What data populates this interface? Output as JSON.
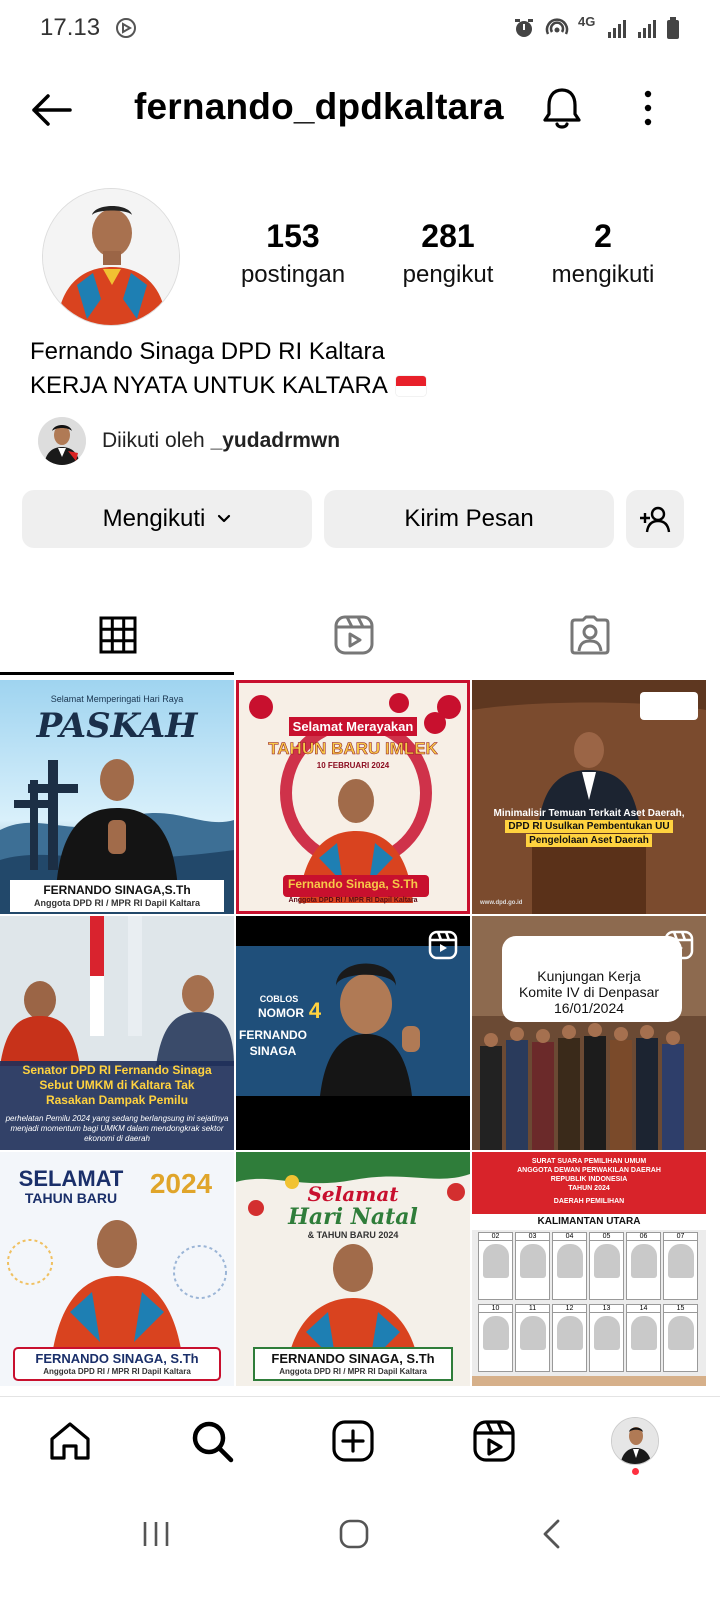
{
  "status_bar": {
    "time": "17.13",
    "network": "4G"
  },
  "header": {
    "username": "fernando_dpdkaltara"
  },
  "profile": {
    "stats": [
      {
        "value": "153",
        "label": "postingan"
      },
      {
        "value": "281",
        "label": "pengikut"
      },
      {
        "value": "2",
        "label": "mengikuti"
      }
    ],
    "display_name": "Fernando Sinaga DPD RI Kaltara",
    "bio": "KERJA NYATA UNTUK KALTARA",
    "followed_by_prefix": "Diikuti oleh",
    "followed_by_user": "_yudadrmwn"
  },
  "actions": {
    "following_label": "Mengikuti",
    "message_label": "Kirim Pesan"
  },
  "posts": [
    {
      "lines": [
        "Selamat Memperingati Hari Raya",
        "PASKAH",
        "FERNANDO SINAGA,S.Th",
        "Anggota DPD RI / MPR RI Dapil Kaltara"
      ]
    },
    {
      "lines": [
        "Selamat Merayakan",
        "TAHUN BARU IMLEK",
        "10 FEBRUARI 2024",
        "Fernando Sinaga, S.Th",
        "Anggota DPD RI / MPR RI Dapil Kaltara"
      ]
    },
    {
      "lines": [
        "Minimalisir Temuan Terkait Aset Daerah,",
        "DPD RI Usulkan Pembentukan UU",
        "Pengelolaan Aset Daerah",
        "www.dpd.go.id"
      ]
    },
    {
      "lines": [
        "Senator DPD RI Fernando Sinaga",
        "Sebut UMKM di Kaltara Tak",
        "Rasakan Dampak Pemilu",
        "perhelatan Pemilu 2024 yang sedang berlangsung ini sejatinya menjadi momentum bagi UMKM dalam mendongkrak sektor ekonomi di daerah"
      ]
    },
    {
      "lines": [
        "COBLOS",
        "NOMOR",
        "4",
        "FERNANDO",
        "SINAGA"
      ],
      "reel": true
    },
    {
      "lines": [
        "Kunjungan Kerja",
        "Komite IV di Denpasar",
        "16/01/2024"
      ],
      "reel": true
    },
    {
      "lines": [
        "SELAMAT",
        "TAHUN BARU",
        "2024",
        "FERNANDO SINAGA, S.Th",
        "Anggota DPD RI / MPR RI Dapil Kaltara"
      ]
    },
    {
      "lines": [
        "Selamat",
        "Hari Natal",
        "& TAHUN BARU 2024",
        "FERNANDO SINAGA, S.Th",
        "Anggota DPD RI / MPR RI Dapil Kaltara"
      ]
    },
    {
      "lines": [
        "SURAT SUARA PEMILIHAN UMUM",
        "ANGGOTA DEWAN PERWAKILAN DAERAH",
        "REPUBLIK INDONESIA",
        "TAHUN 2024",
        "DAERAH PEMILIHAN",
        "KALIMANTAN UTARA"
      ],
      "numbers": [
        "02",
        "03",
        "04",
        "05",
        "06",
        "07",
        "10",
        "11",
        "12",
        "13",
        "14",
        "15"
      ]
    }
  ],
  "colors": {
    "button_bg": "#efefef",
    "notification_dot": "#ff3040",
    "flag_red": "#e8202a"
  },
  "icons": [
    "back-arrow-icon",
    "bell-icon",
    "more-vertical-icon",
    "chevron-down-icon",
    "add-person-icon",
    "grid-icon",
    "reels-icon",
    "tagged-icon",
    "home-icon",
    "search-icon",
    "create-icon",
    "reels-nav-icon"
  ]
}
